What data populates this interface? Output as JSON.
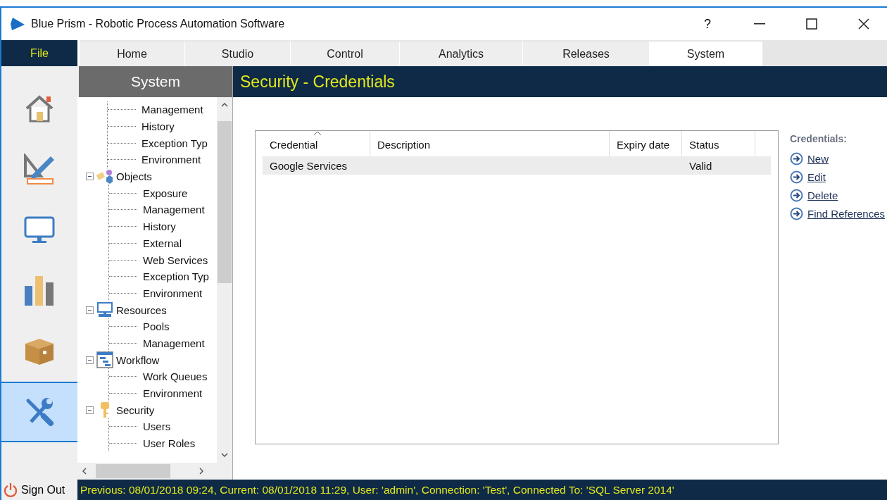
{
  "window": {
    "title": "Blue Prism - Robotic Process Automation Software",
    "controls": [
      "?"
    ]
  },
  "file_tab": "File",
  "tabs": [
    {
      "label": "Home",
      "selected": false
    },
    {
      "label": "Studio",
      "selected": false
    },
    {
      "label": "Control",
      "selected": false
    },
    {
      "label": "Analytics",
      "selected": false
    },
    {
      "label": "Releases",
      "selected": false
    },
    {
      "label": "System",
      "selected": true
    }
  ],
  "sidebar": {
    "items": [
      {
        "kind": "home",
        "selected": false
      },
      {
        "kind": "studio",
        "selected": false
      },
      {
        "kind": "control",
        "selected": false
      },
      {
        "kind": "analytics",
        "selected": false
      },
      {
        "kind": "releases",
        "selected": false
      },
      {
        "kind": "system",
        "selected": true
      }
    ],
    "sign_out": "Sign Out"
  },
  "tree": {
    "title": "System",
    "leading_children": [
      "Management",
      "History",
      "Exception Typ",
      "Environment"
    ],
    "nodes": [
      {
        "label": "Objects",
        "kind": "objects",
        "expanded": true,
        "children": [
          "Exposure",
          "Management",
          "History",
          "External",
          "Web Services",
          "Exception Typ",
          "Environment"
        ]
      },
      {
        "label": "Resources",
        "kind": "resources",
        "expanded": true,
        "children": [
          "Pools",
          "Management"
        ]
      },
      {
        "label": "Workflow",
        "kind": "workflow",
        "expanded": true,
        "children": [
          "Work Queues",
          "Environment"
        ]
      },
      {
        "label": "Security",
        "kind": "security",
        "expanded": true,
        "children": [
          "Users",
          "User Roles"
        ]
      }
    ]
  },
  "page": {
    "title": "Security - Credentials"
  },
  "table": {
    "columns": [
      {
        "label": "Credential",
        "sorted": true
      },
      {
        "label": "Description",
        "sorted": false
      },
      {
        "label": "Expiry date",
        "sorted": false
      },
      {
        "label": "Status",
        "sorted": false
      }
    ],
    "rows": [
      {
        "cells": [
          "Google Services",
          "",
          "",
          "Valid"
        ],
        "selected": true
      }
    ]
  },
  "actions": {
    "title": "Credentials:",
    "links": [
      "New",
      "Edit",
      "Delete",
      "Find References"
    ]
  },
  "status_bar": "Previous: 08/01/2018 09:24, Current: 08/01/2018 11:29, User: 'admin', Connection: 'Test', Connected To: 'SQL Server 2014'"
}
